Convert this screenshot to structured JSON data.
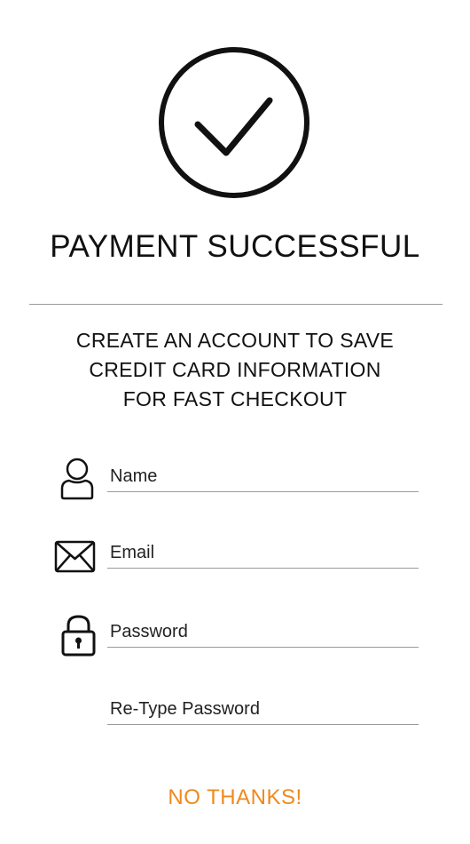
{
  "status": {
    "icon": "checkmark-circle-icon",
    "title": "PAYMENT SUCCESSFUL"
  },
  "promo": {
    "line1": "CREATE AN ACCOUNT TO SAVE",
    "line2": "CREDIT CARD INFORMATION",
    "line3": "FOR FAST CHECKOUT"
  },
  "form": {
    "name": {
      "icon": "user-icon",
      "placeholder": "Name",
      "value": ""
    },
    "email": {
      "icon": "envelope-icon",
      "placeholder": "Email",
      "value": ""
    },
    "password": {
      "icon": "lock-icon",
      "placeholder": "Password",
      "value": ""
    },
    "retype_password": {
      "placeholder": "Re-Type Password",
      "value": ""
    }
  },
  "actions": {
    "no_thanks_label": "NO THANKS!"
  },
  "colors": {
    "accent": "#f0891c",
    "divider": "#9a9a9a",
    "text": "#111111"
  }
}
